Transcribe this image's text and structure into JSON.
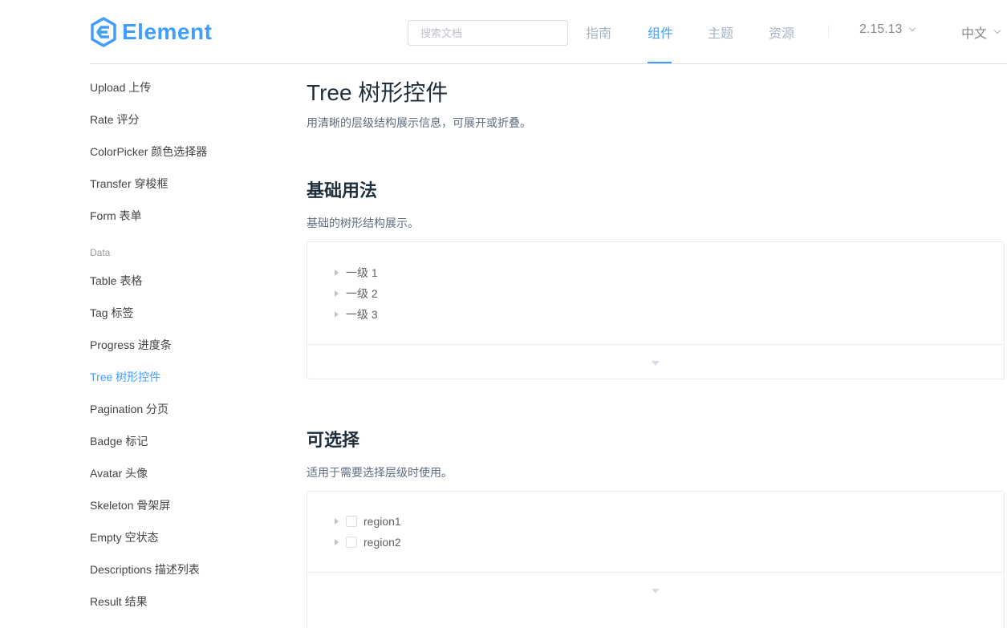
{
  "header": {
    "logo_text": "Element",
    "logo_icon": "hexagon-logo-icon",
    "search_placeholder": "搜索文档",
    "nav": [
      {
        "label": "指南",
        "active": false
      },
      {
        "label": "组件",
        "active": true
      },
      {
        "label": "主题",
        "active": false
      },
      {
        "label": "资源",
        "active": false
      }
    ],
    "version": "2.15.13",
    "language": "中文",
    "accent_color": "#409eff"
  },
  "sidebar": {
    "items_top": [
      "Upload 上传",
      "Rate 评分",
      "ColorPicker 颜色选择器",
      "Transfer 穿梭框",
      "Form 表单"
    ],
    "group_label": "Data",
    "items_data": [
      "Table 表格",
      "Tag 标签",
      "Progress 进度条",
      "Tree 树形控件",
      "Pagination 分页",
      "Badge 标记",
      "Avatar 头像",
      "Skeleton 骨架屏",
      "Empty 空状态",
      "Descriptions 描述列表",
      "Result 结果"
    ],
    "active_item": "Tree 树形控件"
  },
  "main": {
    "title": "Tree 树形控件",
    "description": "用清晰的层级结构展示信息，可展开或折叠。",
    "sections": [
      {
        "title": "基础用法",
        "description": "基础的树形结构展示。",
        "tree": [
          "一级 1",
          "一级 2",
          "一级 3"
        ]
      },
      {
        "title": "可选择",
        "description": "适用于需要选择层级时使用。",
        "tree": [
          "region1",
          "region2"
        ]
      }
    ]
  }
}
